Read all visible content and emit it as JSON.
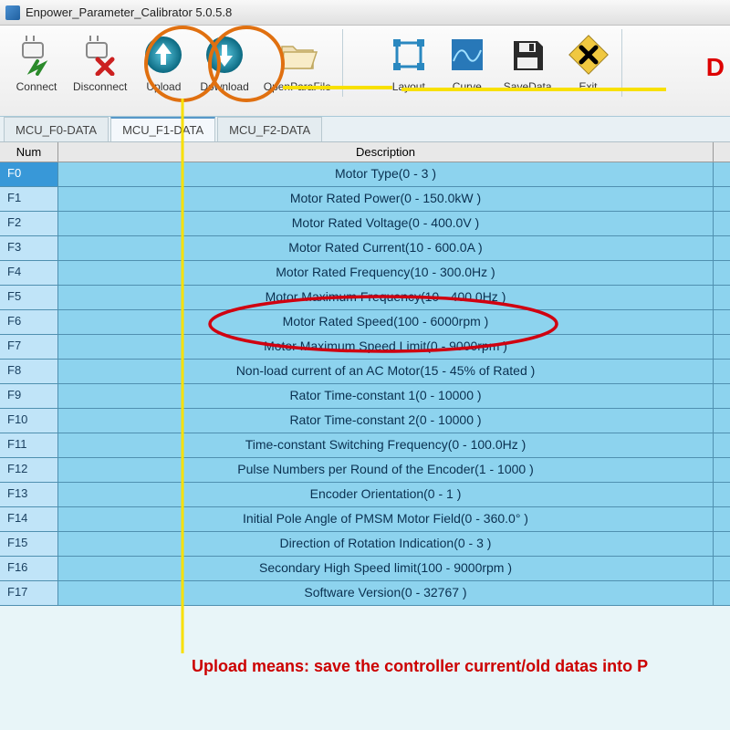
{
  "window": {
    "title": "Enpower_Parameter_Calibrator  5.0.5.8"
  },
  "toolbar": {
    "connect": "Connect",
    "disconnect": "Disconnect",
    "upload": "Upload",
    "download": "Download",
    "openparafile": "OpenParaFile",
    "layout": "Layout",
    "curve": "Curve",
    "savedata": "SaveData",
    "exit": "Exit"
  },
  "tabs": [
    {
      "label": "MCU_F0-DATA"
    },
    {
      "label": "MCU_F1-DATA"
    },
    {
      "label": "MCU_F2-DATA"
    }
  ],
  "grid": {
    "header_num": "Num",
    "header_desc": "Description",
    "rows": [
      {
        "num": "F0",
        "desc": "Motor Type(0 - 3 )"
      },
      {
        "num": "F1",
        "desc": "Motor Rated Power(0 - 150.0kW )"
      },
      {
        "num": "F2",
        "desc": "Motor Rated Voltage(0 - 400.0V )"
      },
      {
        "num": "F3",
        "desc": "Motor Rated Current(10 - 600.0A )"
      },
      {
        "num": "F4",
        "desc": "Motor Rated Frequency(10 - 300.0Hz )"
      },
      {
        "num": "F5",
        "desc": "Motor Maximum Frequency(10 - 400.0Hz )"
      },
      {
        "num": "F6",
        "desc": "Motor Rated Speed(100 - 6000rpm )"
      },
      {
        "num": "F7",
        "desc": "Motor Maximum Speed Limit(0 - 9000rpm )"
      },
      {
        "num": "F8",
        "desc": "Non-load current of an AC Motor(15 - 45% of Rated )"
      },
      {
        "num": "F9",
        "desc": "Rator Time-constant 1(0 - 10000 )"
      },
      {
        "num": "F10",
        "desc": "Rator Time-constant 2(0 - 10000 )"
      },
      {
        "num": "F11",
        "desc": "Time-constant Switching Frequency(0 - 100.0Hz )"
      },
      {
        "num": "F12",
        "desc": "Pulse Numbers per Round of the Encoder(1 - 1000 )"
      },
      {
        "num": "F13",
        "desc": "Encoder Orientation(0 - 1 )"
      },
      {
        "num": "F14",
        "desc": "Initial Pole Angle of PMSM Motor Field(0 - 360.0° )"
      },
      {
        "num": "F15",
        "desc": "Direction of Rotation Indication(0 - 3 )"
      },
      {
        "num": "F16",
        "desc": "Secondary High Speed limit(100 - 9000rpm )"
      },
      {
        "num": "F17",
        "desc": "Software Version(0 - 32767 )"
      }
    ]
  },
  "annotation": {
    "note": "Upload means: save the controller current/old datas into P",
    "red_d": "D"
  }
}
